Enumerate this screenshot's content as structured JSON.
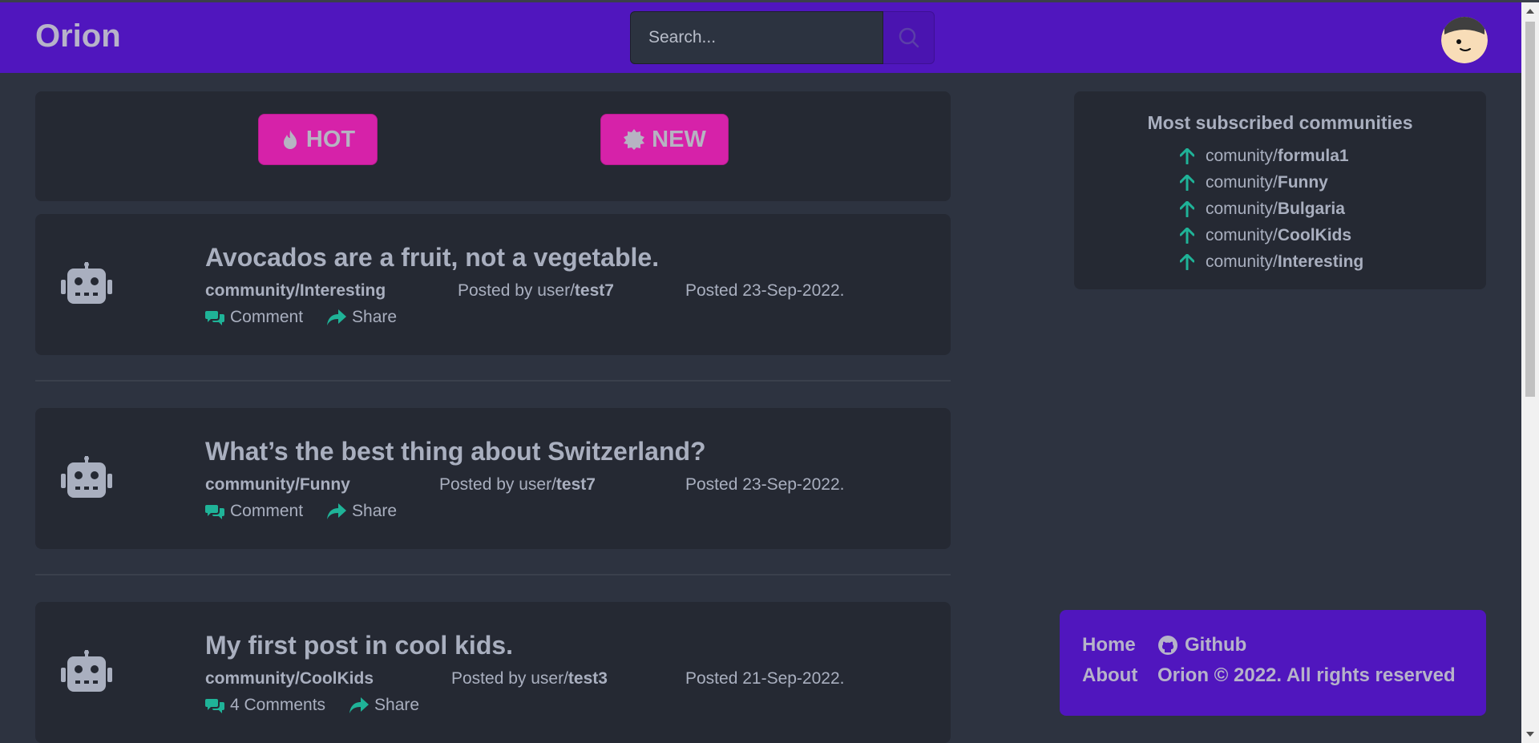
{
  "navbar": {
    "brand": "Orion",
    "search_placeholder": "Search...",
    "search_icon": "search-icon",
    "avatar_icon": "avatar-icon"
  },
  "sort": {
    "hot_label": "HOT",
    "hot_icon": "fire-icon",
    "new_label": "NEW",
    "new_icon": "badge-icon"
  },
  "posts": [
    {
      "title": "Avocados are a fruit, not a vegetable.",
      "community": "community/Interesting",
      "posted_by_prefix": "Posted by user/",
      "user": "test7",
      "date": "Posted 23-Sep-2022.",
      "comment_label": "Comment",
      "share_label": "Share"
    },
    {
      "title": "What’s the best thing about Switzerland?",
      "community": "community/Funny",
      "posted_by_prefix": "Posted by user/",
      "user": "test7",
      "date": "Posted 23-Sep-2022.",
      "comment_label": "Comment",
      "share_label": "Share"
    },
    {
      "title": "My first post in cool kids.",
      "community": "community/CoolKids",
      "posted_by_prefix": "Posted by user/",
      "user": "test3",
      "date": "Posted 21-Sep-2022.",
      "comment_label": "4 Comments",
      "share_label": "Share"
    }
  ],
  "communities": {
    "title": "Most subscribed communities",
    "prefix": "comunity/",
    "items": [
      "formula1",
      "Funny",
      "Bulgaria",
      "CoolKids",
      "Interesting"
    ]
  },
  "footer": {
    "home_label": "Home",
    "github_label": "Github",
    "about_label": "About",
    "copyright": "Orion © 2022. All rights reserved"
  },
  "colors": {
    "brand_purple": "#5016be",
    "accent_pink": "#d622a9",
    "accent_teal": "#1fb398",
    "background": "#2d3340",
    "card": "#252933"
  }
}
